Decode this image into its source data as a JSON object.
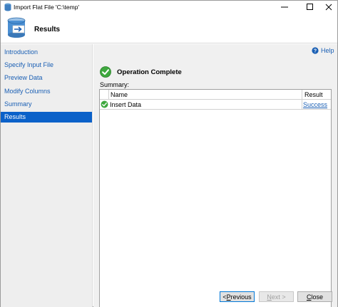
{
  "window": {
    "title": "Import Flat File 'C:\\temp'",
    "controls": {
      "minimize": "minimize-icon",
      "maximize": "maximize-icon",
      "close": "close-icon"
    }
  },
  "header": {
    "title": "Results",
    "icon": "database-import-icon"
  },
  "sidebar": {
    "items": [
      {
        "label": "Introduction",
        "active": false
      },
      {
        "label": "Specify Input File",
        "active": false
      },
      {
        "label": "Preview Data",
        "active": false
      },
      {
        "label": "Modify Columns",
        "active": false
      },
      {
        "label": "Summary",
        "active": false
      },
      {
        "label": "Results",
        "active": true
      }
    ]
  },
  "main": {
    "help_label": "Help",
    "status_title": "Operation Complete",
    "summary_label": "Summary:",
    "table": {
      "columns": [
        "Name",
        "Result"
      ],
      "rows": [
        {
          "name": "Insert Data",
          "result": "Success",
          "status": "success"
        }
      ]
    }
  },
  "footer": {
    "previous": {
      "accel": "P",
      "rest": "revious",
      "prefix": "< "
    },
    "next": {
      "accel": "N",
      "rest": "ext >",
      "prefix": ""
    },
    "close": {
      "accel": "C",
      "rest": "lose",
      "prefix": ""
    }
  },
  "colors": {
    "accent": "#0b61c9",
    "link": "#1a5fb4",
    "success": "#3ea83e"
  }
}
